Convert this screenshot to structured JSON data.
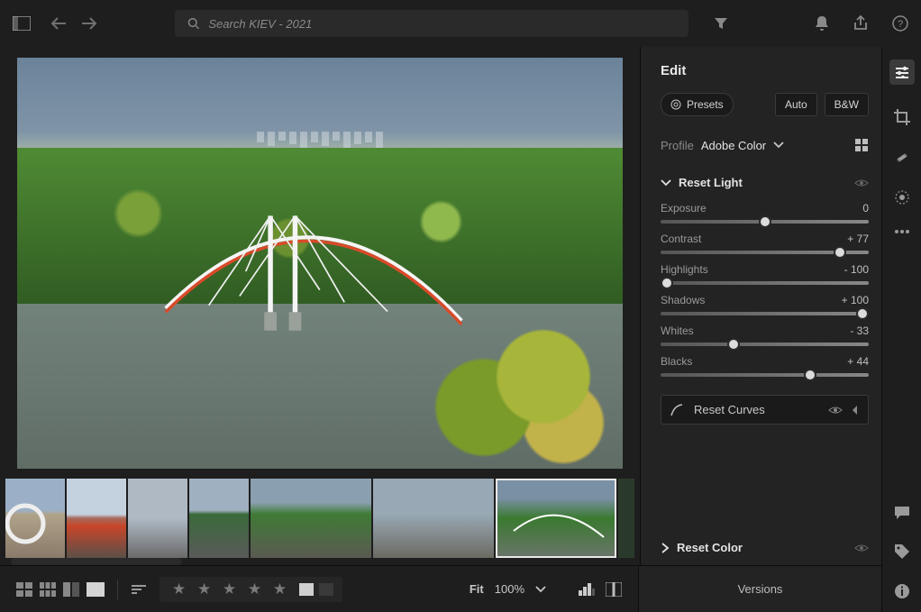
{
  "search": {
    "placeholder": "Search KIEV - 2021"
  },
  "edit": {
    "title": "Edit",
    "presets": "Presets",
    "auto": "Auto",
    "bw": "B&W",
    "profile_label": "Profile",
    "profile_name": "Adobe Color",
    "light_section": "Reset Light",
    "sliders": {
      "exposure": {
        "label": "Exposure",
        "value": "0",
        "pos": 50
      },
      "contrast": {
        "label": "Contrast",
        "value": "+ 77",
        "pos": 86
      },
      "highlights": {
        "label": "Highlights",
        "value": "- 100",
        "pos": 3
      },
      "shadows": {
        "label": "Shadows",
        "value": "+ 100",
        "pos": 97
      },
      "whites": {
        "label": "Whites",
        "value": "- 33",
        "pos": 35
      },
      "blacks": {
        "label": "Blacks",
        "value": "+ 44",
        "pos": 72
      }
    },
    "curves": "Reset Curves",
    "color_section": "Reset Color",
    "versions": "Versions"
  },
  "bottom": {
    "fit": "Fit",
    "zoom": "100%"
  }
}
